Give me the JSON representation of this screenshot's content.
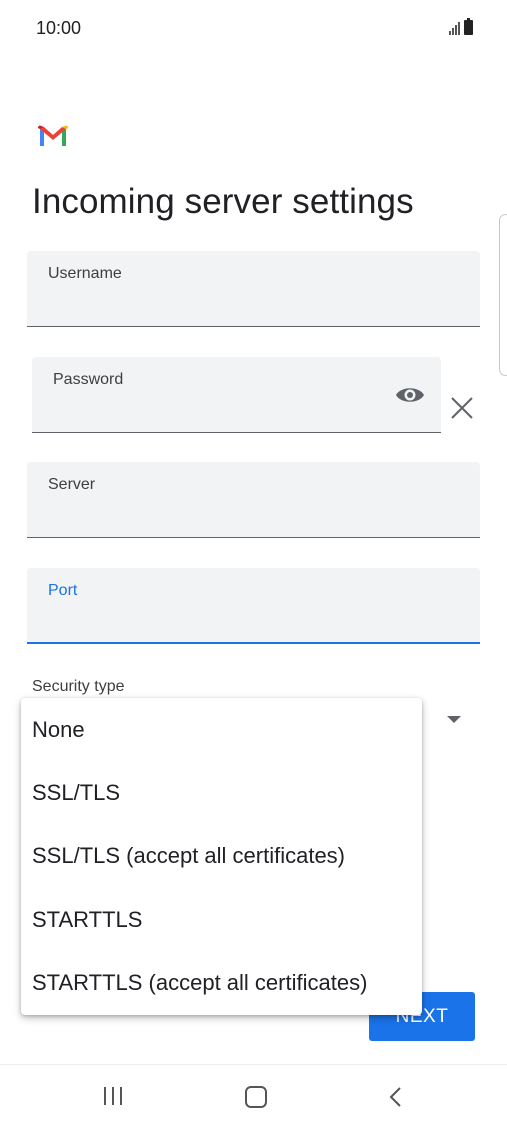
{
  "status_bar": {
    "time": "10:00",
    "icons": [
      "signal-icon",
      "battery-icon"
    ]
  },
  "app": {
    "logo": "gmail-logo"
  },
  "page": {
    "title": "Incoming server settings"
  },
  "fields": {
    "username": {
      "label": "Username",
      "value": ""
    },
    "password": {
      "label": "Password",
      "value": "",
      "visibility_icon": "eye-icon",
      "clear_icon": "close-icon"
    },
    "server": {
      "label": "Server",
      "value": ""
    },
    "port": {
      "label": "Port",
      "value": "",
      "focused": true
    }
  },
  "security": {
    "label": "Security type"
  },
  "dropdown": {
    "options": [
      "None",
      "SSL/TLS",
      "SSL/TLS (accept all certificates)",
      "STARTTLS",
      "STARTTLS (accept all certificates)"
    ]
  },
  "actions": {
    "next_label": "NEXT"
  },
  "nav": {
    "icons": [
      "recents-icon",
      "home-icon",
      "back-icon"
    ]
  },
  "colors": {
    "accent": "#1a73e8",
    "field_bg": "#f1f3f4"
  }
}
